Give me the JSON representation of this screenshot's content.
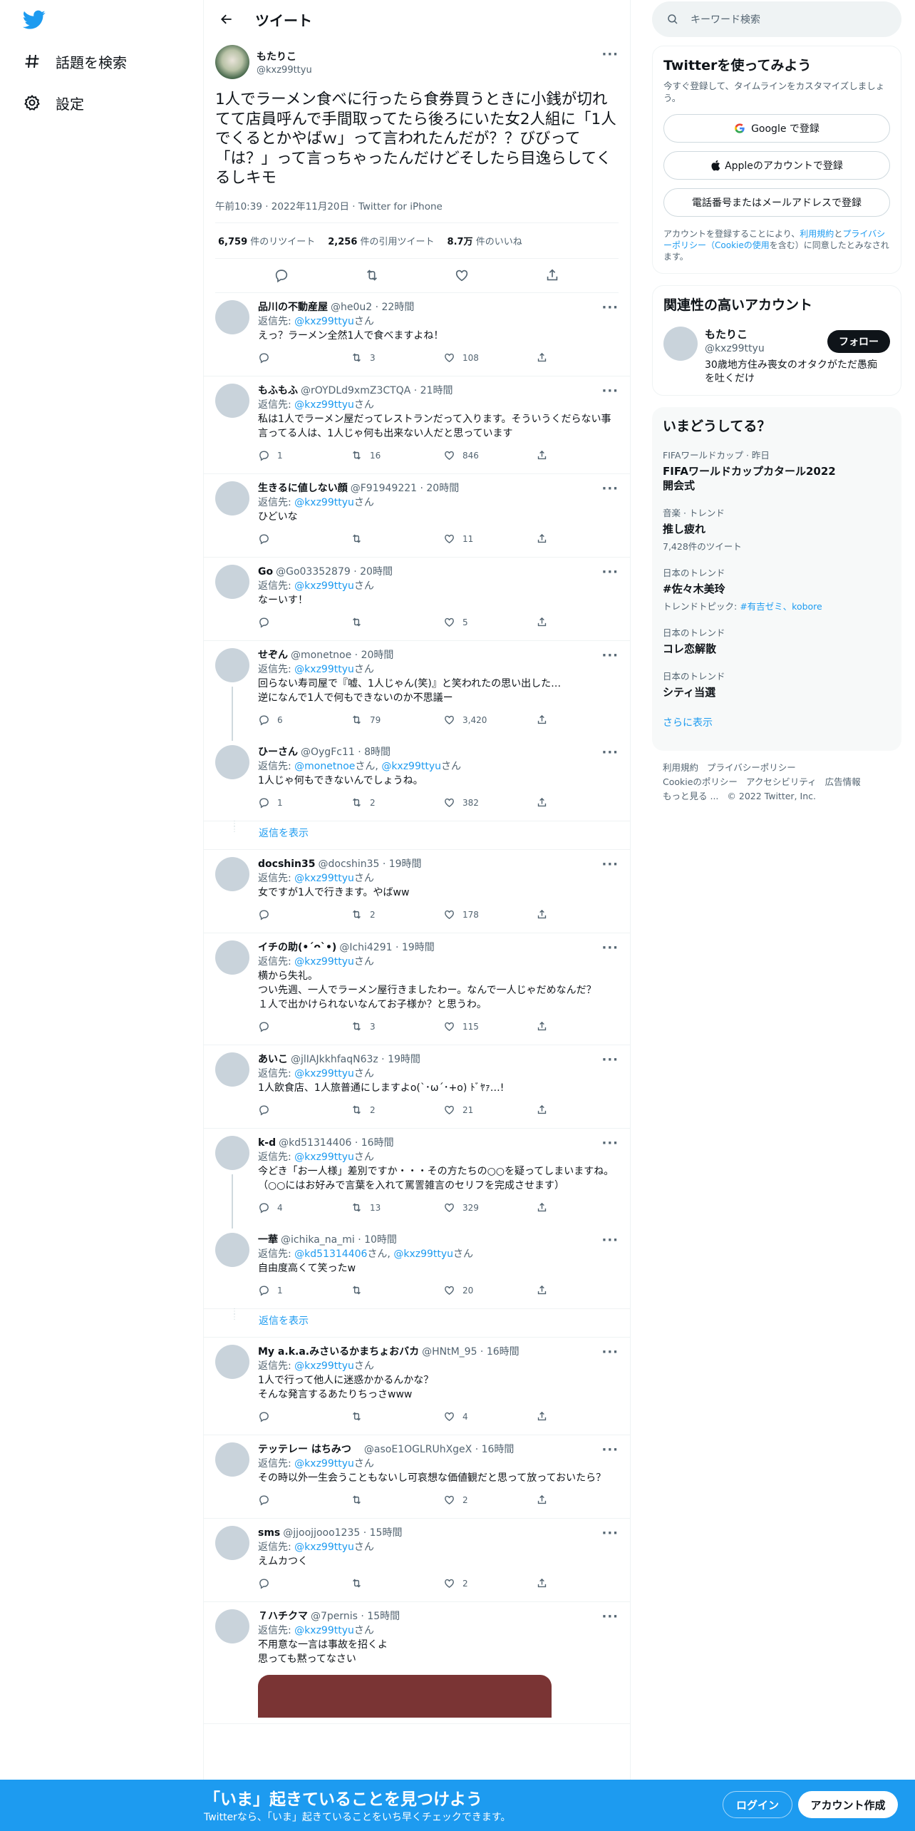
{
  "nav": {
    "explore_label": "話題を検索",
    "settings_label": "設定"
  },
  "header": {
    "title": "ツイート"
  },
  "focal": {
    "name": "もたりこ",
    "handle": "@kxz99ttyu",
    "text": "1人でラーメン食べに行ったら食券買うときに小銭が切れてて店員呼んで手間取ってたら後ろにいた女2人組に「1人でくるとかやばｗ」って言われたんだが？？びびって「は？」って言っちゃったんだけどそしたら目逸らしてくるしキモ",
    "meta": "午前10:39 · 2022年11月20日 · Twitter for iPhone",
    "retweets": "6,759",
    "retweets_label": " 件のリツイート",
    "quotes": "2,256",
    "quotes_label": " 件の引用ツイート",
    "likes": "8.7万",
    "likes_label": " 件のいいね"
  },
  "replies": [
    {
      "name": "品川の不動産屋",
      "handle": "@he0u2 · 22時間",
      "to_prefix": "返信先: ",
      "to": "@kxz99ttyu",
      "to_suffix": "さん",
      "text": "えっ？ラーメン全然1人で食べますよね！",
      "reply": "",
      "retweet": "3",
      "like": "108"
    },
    {
      "name": "もふもふ",
      "handle": "@rOYDLd9xmZ3CTQA · 21時間",
      "to_prefix": "返信先: ",
      "to": "@kxz99ttyu",
      "to_suffix": "さん",
      "text": "私は1人でラーメン屋だってレストランだって入ります。そういうくだらない事言ってる人は、1人じゃ何も出来ない人だと思っています",
      "reply": "1",
      "retweet": "16",
      "like": "846"
    },
    {
      "name": "生きるに値しない顔",
      "handle": "@F91949221 · 20時間",
      "to_prefix": "返信先: ",
      "to": "@kxz99ttyu",
      "to_suffix": "さん",
      "text": "ひどいな",
      "reply": "",
      "retweet": "",
      "like": "11"
    },
    {
      "name": "Go",
      "handle": "@Go03352879 · 20時間",
      "to_prefix": "返信先: ",
      "to": "@kxz99ttyu",
      "to_suffix": "さん",
      "text": "なーいす！",
      "reply": "",
      "retweet": "",
      "like": "5"
    },
    {
      "name": "せぞん",
      "handle": "@monetnoe · 20時間",
      "to_prefix": "返信先: ",
      "to": "@kxz99ttyu",
      "to_suffix": "さん",
      "text": "回らない寿司屋で『嘘、1人じゃん(笑)』と笑われたの思い出した…\n逆になんで1人で何もできないのか不思議ー",
      "reply": "6",
      "retweet": "79",
      "like": "3,420"
    },
    {
      "name": "ひーさん",
      "handle": "@OygFc11 · 8時間",
      "to_prefix": "返信先: ",
      "to": "@monetnoe",
      "to_mid": "さん, ",
      "to2": "@kxz99ttyu",
      "to_suffix": "さん",
      "text": "1人じゃ何もできないんでしょうね。",
      "reply": "1",
      "retweet": "2",
      "like": "382"
    },
    {
      "name": "docshin35",
      "handle": "@docshin35 · 19時間",
      "to_prefix": "返信先: ",
      "to": "@kxz99ttyu",
      "to_suffix": "さん",
      "text": "女ですが1人で行きます。やばww",
      "reply": "",
      "retweet": "2",
      "like": "178"
    },
    {
      "name": "イチの助(•´ᴖ`•)",
      "handle": "@Ichi4291 · 19時間",
      "to_prefix": "返信先: ",
      "to": "@kxz99ttyu",
      "to_suffix": "さん",
      "text": "横から失礼。\nつい先週、一人でラーメン屋行きましたわー。なんで一人じゃだめなんだ？\n１人で出かけられないなんてお子様か？と思うわ。",
      "reply": "",
      "retweet": "3",
      "like": "115"
    },
    {
      "name": "あいこ",
      "handle": "@jlIAJkkhfaqN63z · 19時間",
      "to_prefix": "返信先: ",
      "to": "@kxz99ttyu",
      "to_suffix": "さん",
      "text": "1人飲食店、1人旅普通にしますよo(`･ω´･+o) ﾄﾞﾔｧ…!",
      "reply": "",
      "retweet": "2",
      "like": "21"
    },
    {
      "name": "k-d",
      "handle": "@kd51314406 · 16時間",
      "to_prefix": "返信先: ",
      "to": "@kxz99ttyu",
      "to_suffix": "さん",
      "text": "今どき「お一人様」差別ですか・・・その方たちの○○を疑ってしまいますね。（○○にはお好みで言葉を入れて罵詈雑言のセリフを完成させます）",
      "reply": "4",
      "retweet": "13",
      "like": "329"
    },
    {
      "name": "一華",
      "handle": "@ichika_na_mi · 10時間",
      "to_prefix": "返信先: ",
      "to": "@kd51314406",
      "to_mid": "さん, ",
      "to2": "@kxz99ttyu",
      "to_suffix": "さん",
      "text": "自由度高くて笑ったw",
      "reply": "1",
      "retweet": "",
      "like": "20"
    },
    {
      "name": "My a.k.a.みさいるかまちょおバカ",
      "handle": "@HNtM_95 · 16時間",
      "to_prefix": "返信先: ",
      "to": "@kxz99ttyu",
      "to_suffix": "さん",
      "text": "1人で行って他人に迷惑かかるんかな？\nそんな発言するあたりちっさwww",
      "reply": "",
      "retweet": "",
      "like": "4"
    },
    {
      "name": "テッテレー はちみつ",
      "handle": "　@asoE1OGLRUhXgeX · 16時間",
      "to_prefix": "返信先: ",
      "to": "@kxz99ttyu",
      "to_suffix": "さん",
      "text": "その時以外一生会うこともないし可哀想な価値観だと思って放っておいたら？",
      "reply": "",
      "retweet": "",
      "like": "2"
    },
    {
      "name": "sms",
      "handle": "@jjoojjooo1235 · 15時間",
      "to_prefix": "返信先: ",
      "to": "@kxz99ttyu",
      "to_suffix": "さん",
      "text": "えムカつく",
      "reply": "",
      "retweet": "",
      "like": "2"
    },
    {
      "name": "７ハチクマ",
      "handle": "@7pernis · 15時間",
      "to_prefix": "返信先: ",
      "to": "@kxz99ttyu",
      "to_suffix": "さん",
      "text": "不用意な一言は事故を招くよ\n思っても黙ってなさい",
      "reply": "",
      "retweet": "",
      "like": ""
    }
  ],
  "show_replies_label": "返信を表示",
  "right": {
    "search_placeholder": "キーワード検索",
    "signup": {
      "title": "Twitterを使ってみよう",
      "subtitle": "今すぐ登録して、タイムラインをカスタマイズしましょう。",
      "google": "Google で登録",
      "apple": "Appleのアカウントで登録",
      "phone": "電話番号またはメールアドレスで登録",
      "legal_1": "アカウントを登録することにより、",
      "legal_terms": "利用規約",
      "legal_2": "と",
      "legal_privacy": "プライバシーポリシー（Cookieの使用",
      "legal_3": "を含む）に同意したとみなされます。"
    },
    "related": {
      "title": "関連性の高いアカウント",
      "name": "もたりこ",
      "handle": "@kxz99ttyu",
      "bio": "30歳地方住み喪女のオタクがただ愚痴を吐くだけ",
      "follow": "フォロー"
    },
    "trends": {
      "title": "いまどうしてる？",
      "items": [
        {
          "ctx": "FIFAワールドカップ · 昨日",
          "title": "FIFAワールドカップカタール2022\n開会式",
          "count": ""
        },
        {
          "ctx": "音楽 · トレンド",
          "title": "推し疲れ",
          "count": "7,428件のツイート"
        },
        {
          "ctx": "日本のトレンド",
          "title": "#佐々木美玲",
          "count_prefix": "トレンドトピック: ",
          "count_links": "#有吉ゼミ、kobore"
        },
        {
          "ctx": "日本のトレンド",
          "title": "コレ恋解散",
          "count": ""
        },
        {
          "ctx": "日本のトレンド",
          "title": "シティ当選",
          "count": ""
        }
      ],
      "more": "さらに表示"
    },
    "footer": {
      "terms": "利用規約",
      "privacy": "プライバシーポリシー",
      "cookie": "Cookieのポリシー",
      "access": "アクセシビリティ",
      "ads": "広告情報",
      "more": "もっと見る ...",
      "copy": "© 2022 Twitter, Inc."
    }
  },
  "bottom": {
    "headline": "「いま」起きていることを見つけよう",
    "sub": "Twitterなら、「いま」起きていることをいち早くチェックできます。",
    "login": "ログイン",
    "signup": "アカウント作成"
  },
  "colors": {
    "accent": "#1d9bf0",
    "text": "#0f1419",
    "muted": "#536471",
    "banner": "#1d9bf0"
  }
}
